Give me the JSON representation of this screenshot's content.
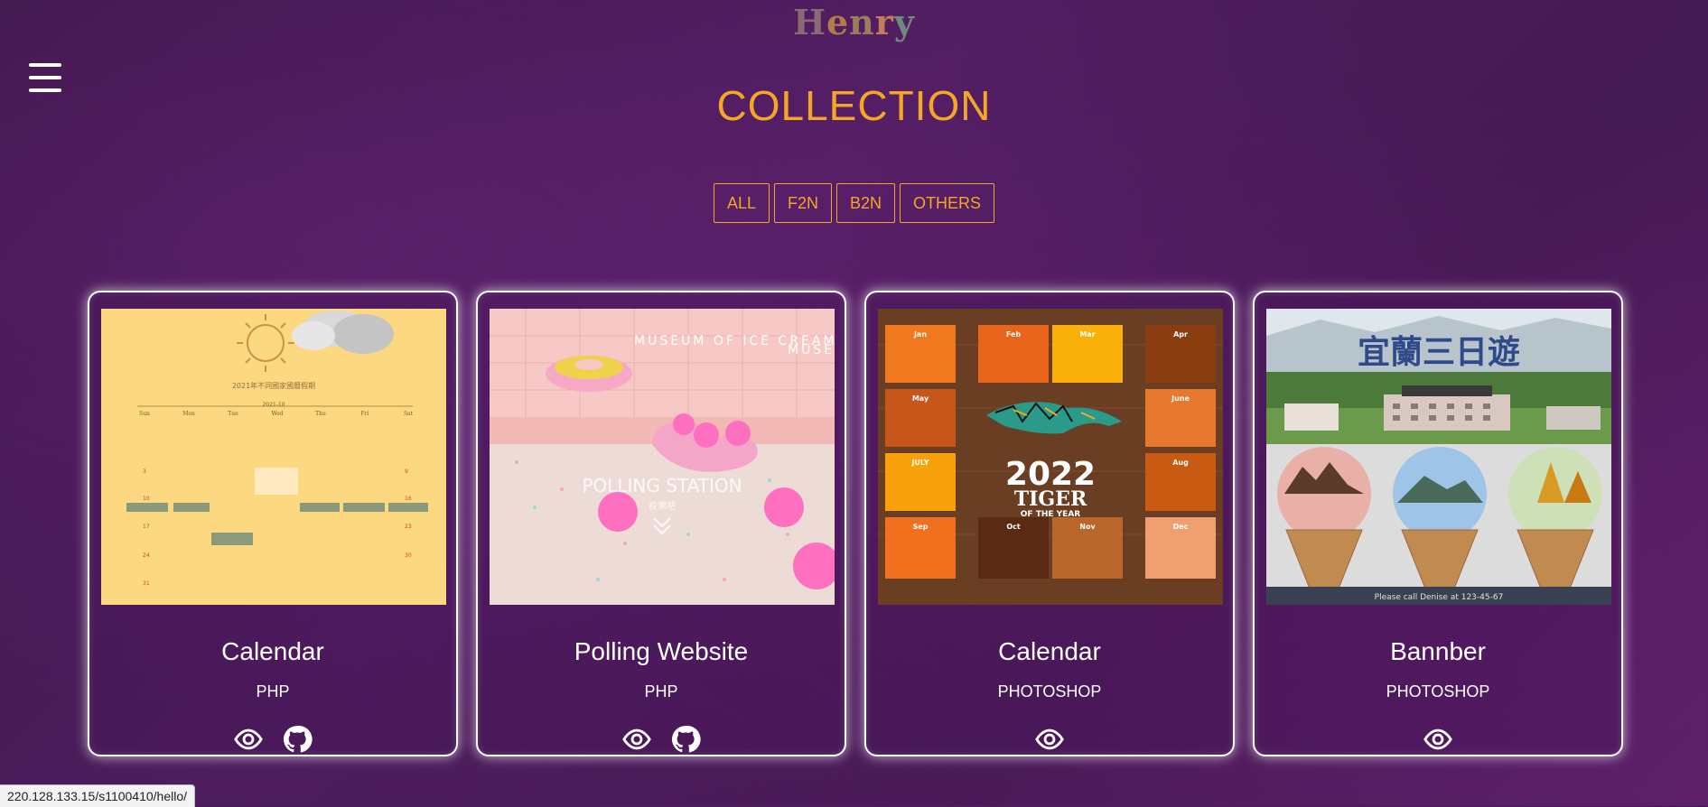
{
  "header": {
    "logo_letters": [
      "H",
      "e",
      "n",
      "r",
      "y"
    ],
    "section_title": "COLLECTION"
  },
  "filters": [
    "ALL",
    "F2N",
    "B2N",
    "OTHERS"
  ],
  "cards": [
    {
      "title": "Calendar",
      "tag": "PHP",
      "icons": [
        "eye-icon",
        "github-icon"
      ],
      "thumb_text": [
        "2021年不同國家國曆假期",
        "2021-10",
        "Sun",
        "Mon",
        "Tue",
        "Wed",
        "Thu",
        "Fri",
        "Sat"
      ]
    },
    {
      "title": "Polling Website",
      "tag": "PHP",
      "icons": [
        "eye-icon",
        "github-icon"
      ],
      "thumb_text": [
        "MUSEUM OF ICE CREAM",
        "MUSE",
        "POLLING STATION",
        "投票吧"
      ]
    },
    {
      "title": "Calendar",
      "tag": "PHOTOSHOP",
      "icons": [
        "eye-icon"
      ],
      "thumb_text": [
        "2022",
        "TIGER",
        "OF THE YEAR",
        "Jan",
        "Feb",
        "Mar",
        "Apr",
        "May",
        "June",
        "JULY",
        "Aug",
        "Sep",
        "Oct",
        "Nov",
        "Dec"
      ]
    },
    {
      "title": "Bannber",
      "tag": "PHOTOSHOP",
      "icons": [
        "eye-icon"
      ],
      "thumb_text": [
        "宜蘭三日遊",
        "Please call Denise at 123-45-67"
      ]
    }
  ],
  "status_bar": "220.128.133.15/s1100410/hello/",
  "colors": {
    "accent": "#f5a623",
    "background": "#4a1b5a",
    "card_border": "#ffffff"
  }
}
